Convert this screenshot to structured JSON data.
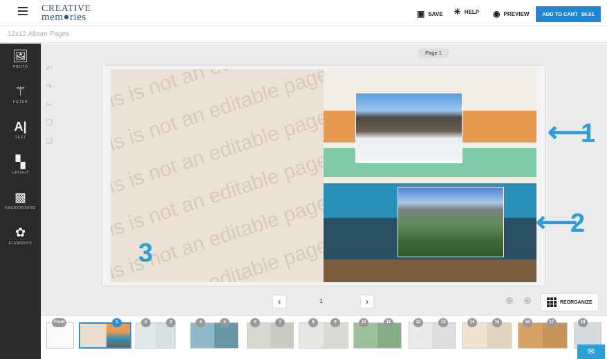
{
  "header": {
    "logo_line1": "CREATIVE",
    "logo_line2": "mem●ries",
    "save_label": "SAVE",
    "help_label": "HELP",
    "preview_label": "PREVIEW",
    "cart_label": "ADD TO CART",
    "cart_price": "$0.01"
  },
  "breadcrumb": "12x12 Album Pages",
  "sidebar": {
    "items": [
      {
        "label": "PHOTO",
        "icon": "photo-icon"
      },
      {
        "label": "FILTER",
        "icon": "magic-wand-icon"
      },
      {
        "label": "TEXT",
        "icon": "text-icon"
      },
      {
        "label": "LAYOUT",
        "icon": "layout-icon"
      },
      {
        "label": "BACKGROUND",
        "icon": "background-icon"
      },
      {
        "label": "ELEMENTS",
        "icon": "elements-icon"
      }
    ]
  },
  "canvas": {
    "page_label": "Page 1",
    "watermark": "This is not an editable page.",
    "callouts": [
      "1",
      "2",
      "3"
    ]
  },
  "nav": {
    "prev": "‹",
    "next": "›",
    "current_page": "1",
    "reorganize_label": "REORGANIZE"
  },
  "thumbnails": {
    "front_label": "Front",
    "badges": [
      "1",
      "2",
      "3",
      "4",
      "5",
      "6",
      "7",
      "8",
      "9",
      "10",
      "11",
      "12",
      "13",
      "14",
      "15",
      "16",
      "17",
      "18"
    ]
  },
  "colors": {
    "accent": "#1e88d6",
    "callout": "#2d9fd4",
    "sidebar_bg": "#2a2a2a"
  }
}
